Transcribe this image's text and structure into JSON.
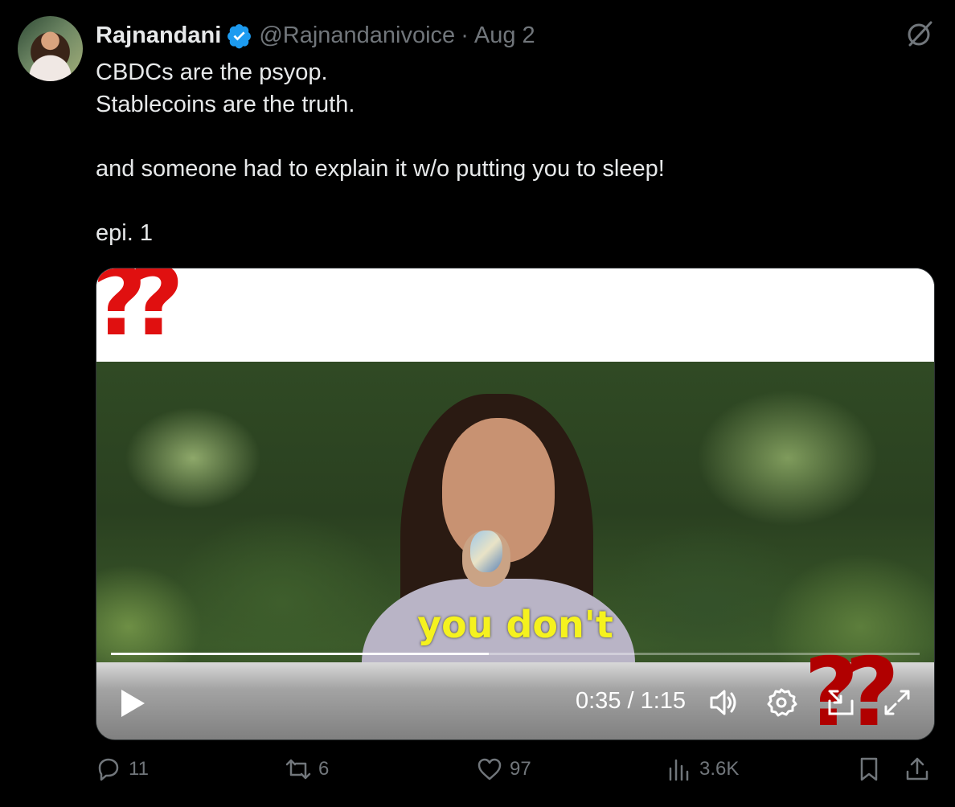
{
  "author": {
    "name": "Rajnandani",
    "handle": "@Rajnandanivoice",
    "separator": "·",
    "date": "Aug 2",
    "verified_color": "#1d9bf0"
  },
  "tweet": {
    "lines": [
      "CBDCs are the psyop.",
      "Stablecoins are the truth.",
      "",
      "and someone had to explain it w/o putting you to sleep!",
      "",
      "epi. 1"
    ]
  },
  "video": {
    "subtitle": "you don't",
    "current_time": "0:35",
    "duration": "1:15",
    "time_display": "0:35 / 1:15",
    "progress_fraction": 0.467,
    "overlay_marks_top": "??",
    "overlay_marks_bottom": "??",
    "controls": [
      "play-icon",
      "volume-icon",
      "settings-icon",
      "pip-icon",
      "fullscreen-icon"
    ]
  },
  "actions": {
    "replies": "11",
    "reposts": "6",
    "likes": "97",
    "views": "3.6K"
  },
  "colors": {
    "background": "#000000",
    "text": "#e7e9ea",
    "muted": "#71767b",
    "subtitle": "#f5f21e",
    "accent_red": "#e01010"
  }
}
